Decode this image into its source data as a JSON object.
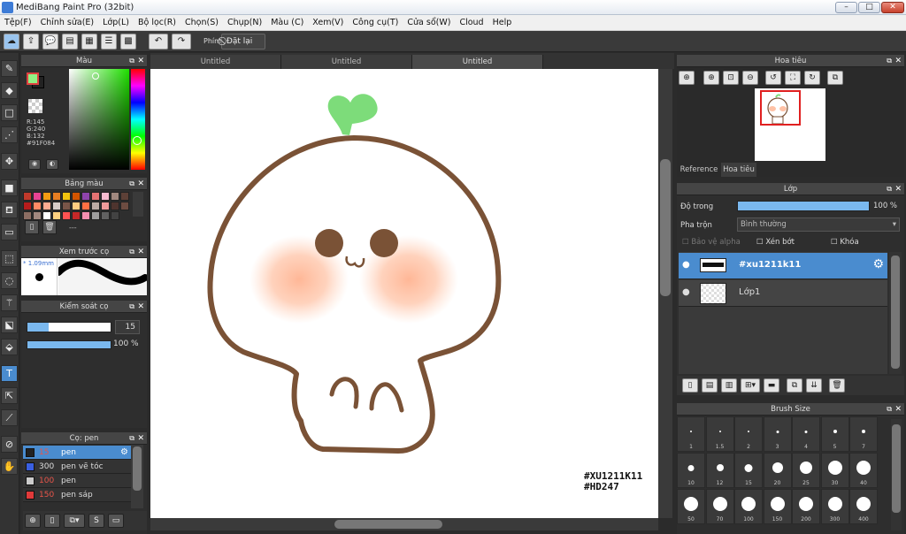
{
  "window": {
    "title": "MediBang Paint Pro (32bit)",
    "min_label": "–",
    "max_label": "□",
    "close_label": "✕"
  },
  "menu": [
    "Tệp(F)",
    "Chỉnh sửa(E)",
    "Lớp(L)",
    "Bộ lọc(R)",
    "Chọn(S)",
    "Chụp(N)",
    "Màu (C)",
    "Xem(V)",
    "Công cụ(T)",
    "Cửa sổ(W)",
    "Cloud",
    "Help"
  ],
  "toolbar": {
    "phim_label": "Phím",
    "reset_label": "Đặt lại"
  },
  "tabs": [
    "Untitled",
    "Untitled",
    "Untitled"
  ],
  "color_panel": {
    "title": "Màu",
    "r": "R:145",
    "g": "G:240",
    "b": "B:132",
    "hex": "#91F084",
    "fg_color": "#91F084"
  },
  "palette_panel": {
    "title": "Bảng màu",
    "extra": "---",
    "swatches": [
      "#c0392b",
      "#e84393",
      "#f39c12",
      "#e67e22",
      "#f1c40f",
      "#d35400",
      "#8e44ad",
      "#e57373",
      "#f8bbd0",
      "#a1887f",
      "#5d4037",
      "#b71c1c",
      "#ff8a65",
      "#ffab91",
      "#d7ccc8",
      "#795548",
      "#ffcc80",
      "#ff7043",
      "#bcaaa4",
      "#ef9a9a",
      "#4e342e",
      "#6d4c41",
      "#8d6e63",
      "#a1887f",
      "#ffffff",
      "#ffd180",
      "#ff5252",
      "#c62828",
      "#f48fb1",
      "#9e9e9e",
      "#616161",
      "#424242"
    ]
  },
  "brush_preview": {
    "title": "Xem trước cọ",
    "size": "1.09mm"
  },
  "brush_control": {
    "title": "Kiểm soát cọ",
    "size_value": "15",
    "opacity_value": "100 %",
    "size_fraction": 0.25,
    "opacity_fraction": 1.0
  },
  "brush_list": {
    "title": "Cọ: pen",
    "items": [
      {
        "num": "15",
        "name": "pen",
        "color": "#222222",
        "selected": true
      },
      {
        "num": "300",
        "name": "pen vẽ tóc",
        "color": "#3a5fe0",
        "selected": false
      },
      {
        "num": "100",
        "name": "pen",
        "color": "#cccccc",
        "selected": false
      },
      {
        "num": "150",
        "name": "pen sáp",
        "color": "#e03a3a",
        "selected": false
      }
    ]
  },
  "navigator": {
    "title": "Hoa tiêu",
    "tab_reference": "Reference",
    "tab_navigator": "Hoa tiêu"
  },
  "layers": {
    "title": "Lớp",
    "opacity_label": "Độ trong",
    "opacity_value": "100 %",
    "opacity_fraction": 1.0,
    "blend_label": "Pha trộn",
    "blend_value": "Bình thường",
    "protect_alpha": "Bảo vệ alpha",
    "clipping": "Xén bớt",
    "lock": "Khóa",
    "items": [
      {
        "name": "#xu1211k11",
        "selected": true
      },
      {
        "name": "Lớp1",
        "selected": false
      }
    ]
  },
  "brush_size": {
    "title": "Brush Size",
    "sizes": [
      "1",
      "1.5",
      "2",
      "3",
      "4",
      "5",
      "7",
      "10",
      "12",
      "15",
      "20",
      "25",
      "30",
      "40",
      "50",
      "70",
      "100",
      "150",
      "200",
      "300",
      "400"
    ]
  },
  "canvas_text": {
    "line1": "#XU1211K11",
    "line2": "#HD247"
  }
}
